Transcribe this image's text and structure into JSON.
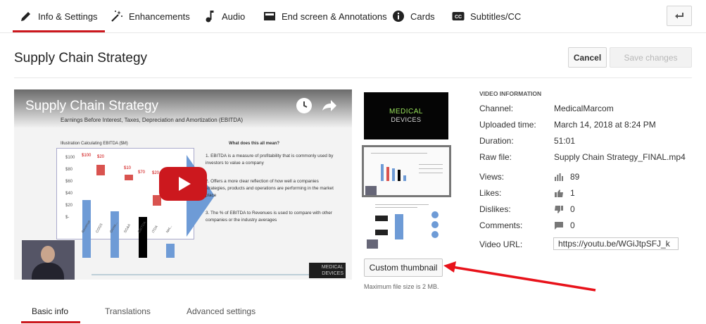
{
  "top_tabs": {
    "info_settings": "Info & Settings",
    "enhancements": "Enhancements",
    "audio": "Audio",
    "end_screen": "End screen & Annotations",
    "cards": "Cards",
    "subtitles": "Subtitles/CC"
  },
  "header": {
    "title": "Supply Chain Strategy",
    "cancel_label": "Cancel",
    "save_label": "Save changes"
  },
  "player": {
    "video_title": "Supply Chain Strategy",
    "slide_subtitle": "Earnings Before Interest, Taxes, Depreciation and Amortization (EBITDA)",
    "illustration_label": "Illustration Calculating EBITDA ($M)",
    "question": "What does this all mean?",
    "points": [
      "1.   EBITDA is a measure of profitability that is commonly used by investors to value a company",
      "2.   Offers a more clear reflection of how well a companies strategies, products and operations are performing in the market place",
      "3.   The % of EBITDA to Revenues is used to compare with other companies or the industry averages"
    ],
    "bar_labels": [
      "$100",
      "$20",
      "$10",
      "$10",
      "$70",
      "$20"
    ],
    "y_ticks": [
      "$100",
      "$80",
      "$60",
      "$40",
      "$20",
      "$-"
    ],
    "x_labels": [
      "Revenue",
      "COGS",
      "Gross...",
      "SG&A",
      "EBITDA",
      "ITDA",
      "Net..."
    ],
    "logo_text_1": "MEDICAL",
    "logo_text_2": "DEVICES"
  },
  "thumbnails": {
    "thumb1_line1": "MEDICAL",
    "thumb1_line2": "DEVICES",
    "custom_button": "Custom thumbnail",
    "max_file_note": "Maximum file size is 2 MB."
  },
  "video_info": {
    "heading": "VIDEO INFORMATION",
    "channel_label": "Channel:",
    "channel_value": "MedicalMarcom",
    "uploaded_label": "Uploaded time:",
    "uploaded_value": "March 14, 2018 at 8:24 PM",
    "duration_label": "Duration:",
    "duration_value": "51:01",
    "raw_file_label": "Raw file:",
    "raw_file_value": "Supply Chain Strategy_FINAL.mp4",
    "views_label": "Views:",
    "views_value": "89",
    "likes_label": "Likes:",
    "likes_value": "1",
    "dislikes_label": "Dislikes:",
    "dislikes_value": "0",
    "comments_label": "Comments:",
    "comments_value": "0",
    "url_label": "Video URL:",
    "url_value": "https://youtu.be/WGiJtpSFJ_k"
  },
  "bottom_tabs": {
    "basic": "Basic info",
    "translations": "Translations",
    "advanced": "Advanced settings"
  },
  "colors": {
    "accent_red": "#cc181e",
    "annotation_red": "#e8121a"
  }
}
